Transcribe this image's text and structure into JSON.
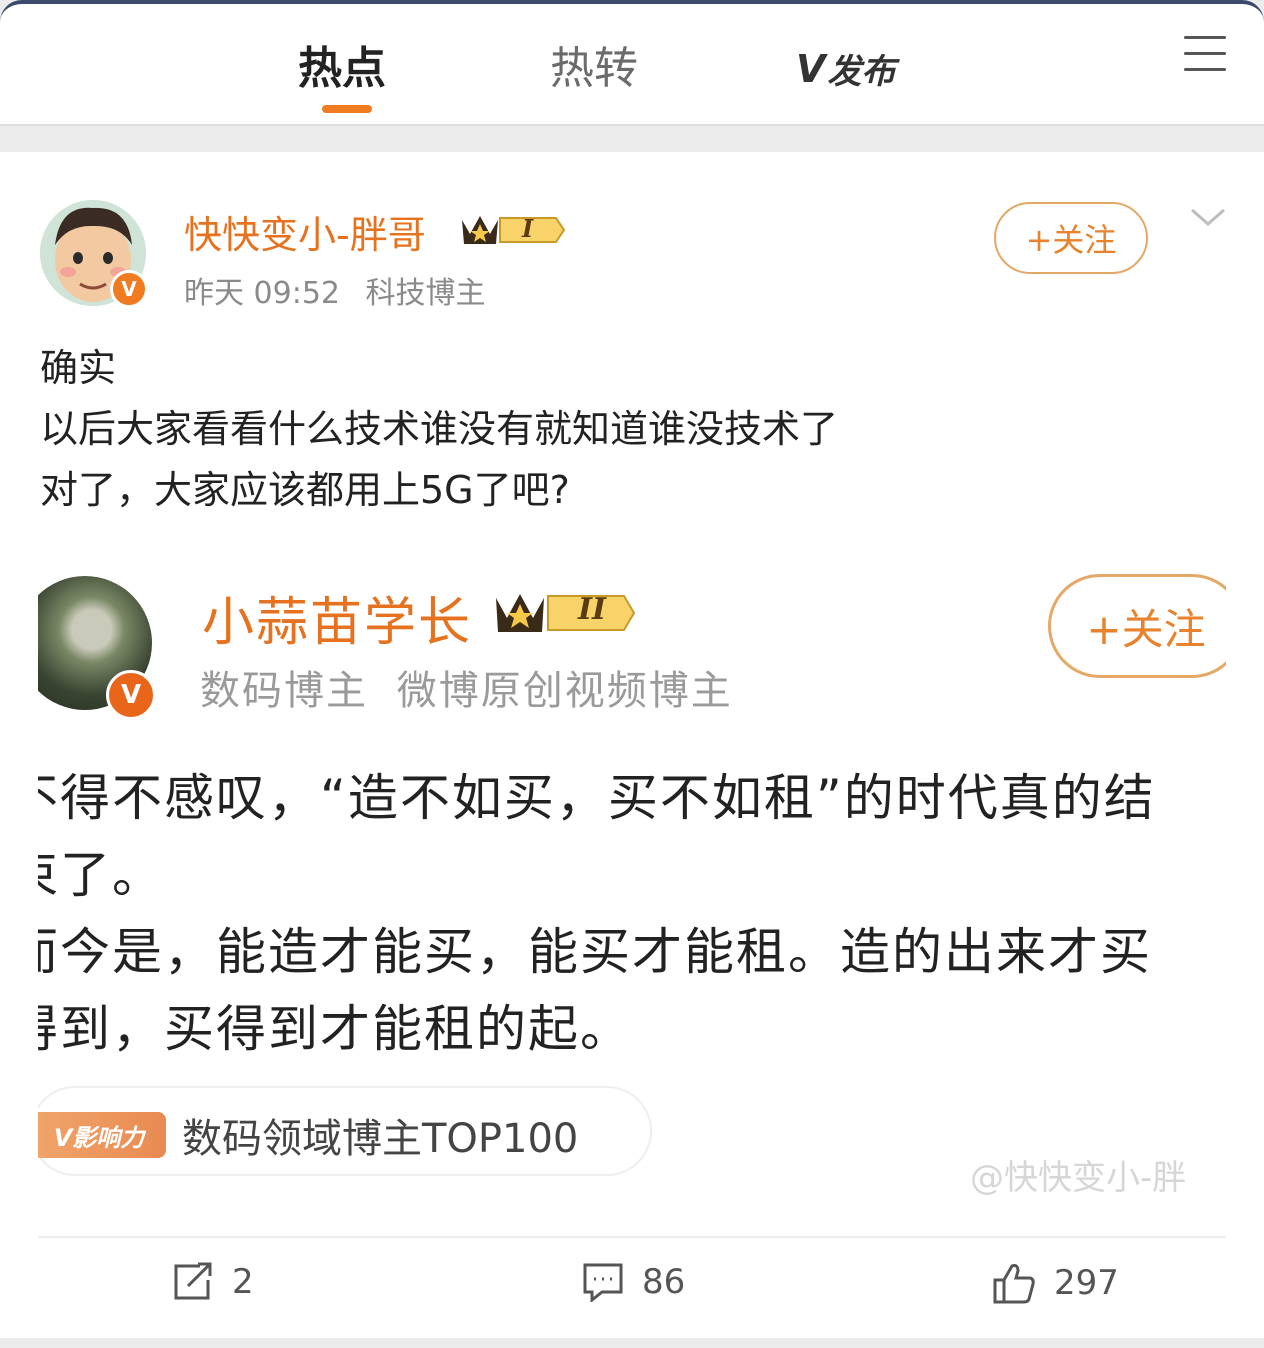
{
  "nav": {
    "tabs": [
      {
        "label": "热点",
        "active": true
      },
      {
        "label": "热转",
        "active": false
      }
    ],
    "vfabu": {
      "mark": "V",
      "label": "发布"
    },
    "accent_color": "#f07b20"
  },
  "post": {
    "author": "快快变小-胖哥",
    "crown_level": "I",
    "time": "昨天 09:52",
    "tag": "科技博主",
    "follow_label": "+关注",
    "verified_mark": "V",
    "lines": [
      "确实",
      "以后大家看看什么技术谁没有就知道谁没技术了",
      "对了，大家应该都用上5G了吧?"
    ]
  },
  "embedded": {
    "author": "小蒜苗学长",
    "crown_level": "II",
    "tags": [
      "数码博主",
      "微博原创视频博主"
    ],
    "follow_label": "+关注",
    "verified_mark": "V",
    "lines": [
      "不得不感叹，“造不如买，买不如租”的时代真的结",
      "束了。",
      "而今是，能造才能买，能买才能租。造的出来才买",
      "得到，买得到才能租的起。"
    ],
    "influence_badge": "V影响力",
    "influence_text": "数码领域博主TOP100",
    "watermark": "@快快变小-胖"
  },
  "actions": {
    "repost": "2",
    "comment": "86",
    "like": "297"
  }
}
